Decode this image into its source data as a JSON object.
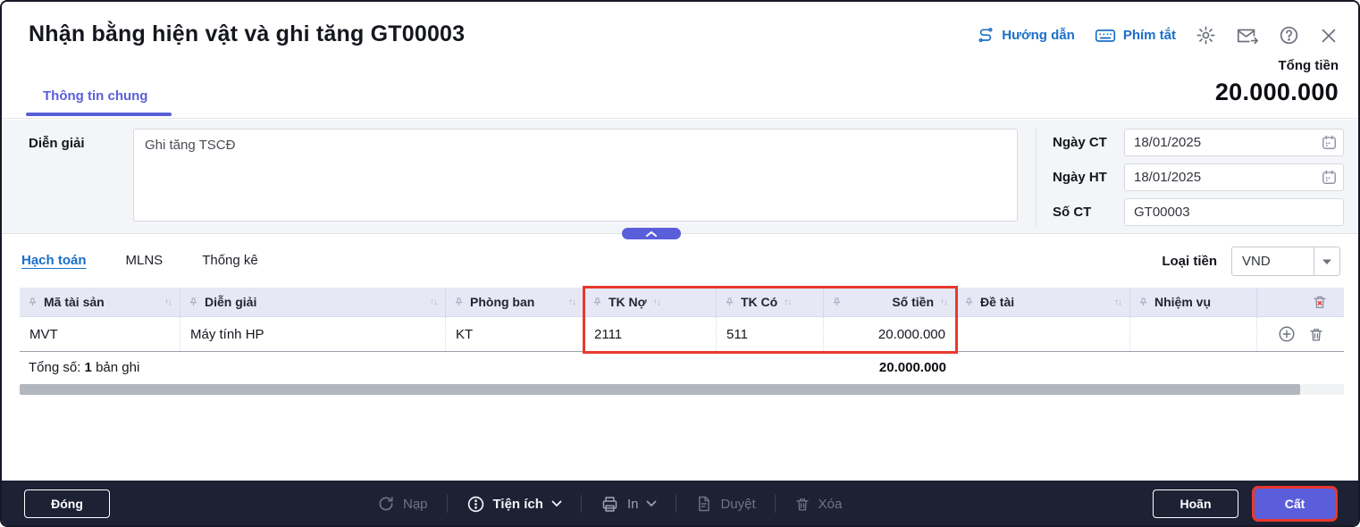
{
  "header": {
    "title": "Nhận bằng hiện vật và ghi tăng GT00003",
    "guide_link": "Hướng dẫn",
    "shortcut_link": "Phím tắt",
    "total_label": "Tổng tiền",
    "total_value": "20.000.000",
    "tab": "Thông tin chung"
  },
  "form": {
    "description_label": "Diễn giải",
    "description_value": "Ghi tăng TSCĐ",
    "fields": [
      {
        "label": "Ngày CT",
        "value": "18/01/2025"
      },
      {
        "label": "Ngày HT",
        "value": "18/01/2025"
      },
      {
        "label": "Số CT",
        "value": "GT00003"
      }
    ]
  },
  "detail": {
    "tabs": [
      {
        "label": "Hạch toán"
      },
      {
        "label": "MLNS"
      },
      {
        "label": "Thống kê"
      }
    ],
    "currency_label": "Loại tiền",
    "currency_value": "VND",
    "table": {
      "columns": [
        "Mã tài sản",
        "Diễn giải",
        "Phòng ban",
        "TK Nợ",
        "TK Có",
        "Số tiền",
        "Đề tài",
        "Nhiệm vụ"
      ],
      "rows": [
        [
          "MVT",
          "Máy tính HP",
          "KT",
          "2111",
          "511",
          "20.000.000",
          "",
          ""
        ]
      ],
      "footer": {
        "count_prefix": "Tổng số:",
        "count": "1",
        "count_suffix": "bản ghi",
        "total_amount": "20.000.000"
      }
    }
  },
  "footer_bar": {
    "close": "Đóng",
    "reload": "Nạp",
    "utilities": "Tiện ích",
    "print": "In",
    "approve": "Duyệt",
    "delete": "Xóa",
    "postpone": "Hoãn",
    "save": "Cất"
  },
  "colors": {
    "accent_indigo": "#5a5edb",
    "link_blue": "#1a6fc9",
    "highlight_red": "#e8392e",
    "table_header_bg": "#e7e8f6",
    "bottom_bar_bg": "#1d2134"
  }
}
